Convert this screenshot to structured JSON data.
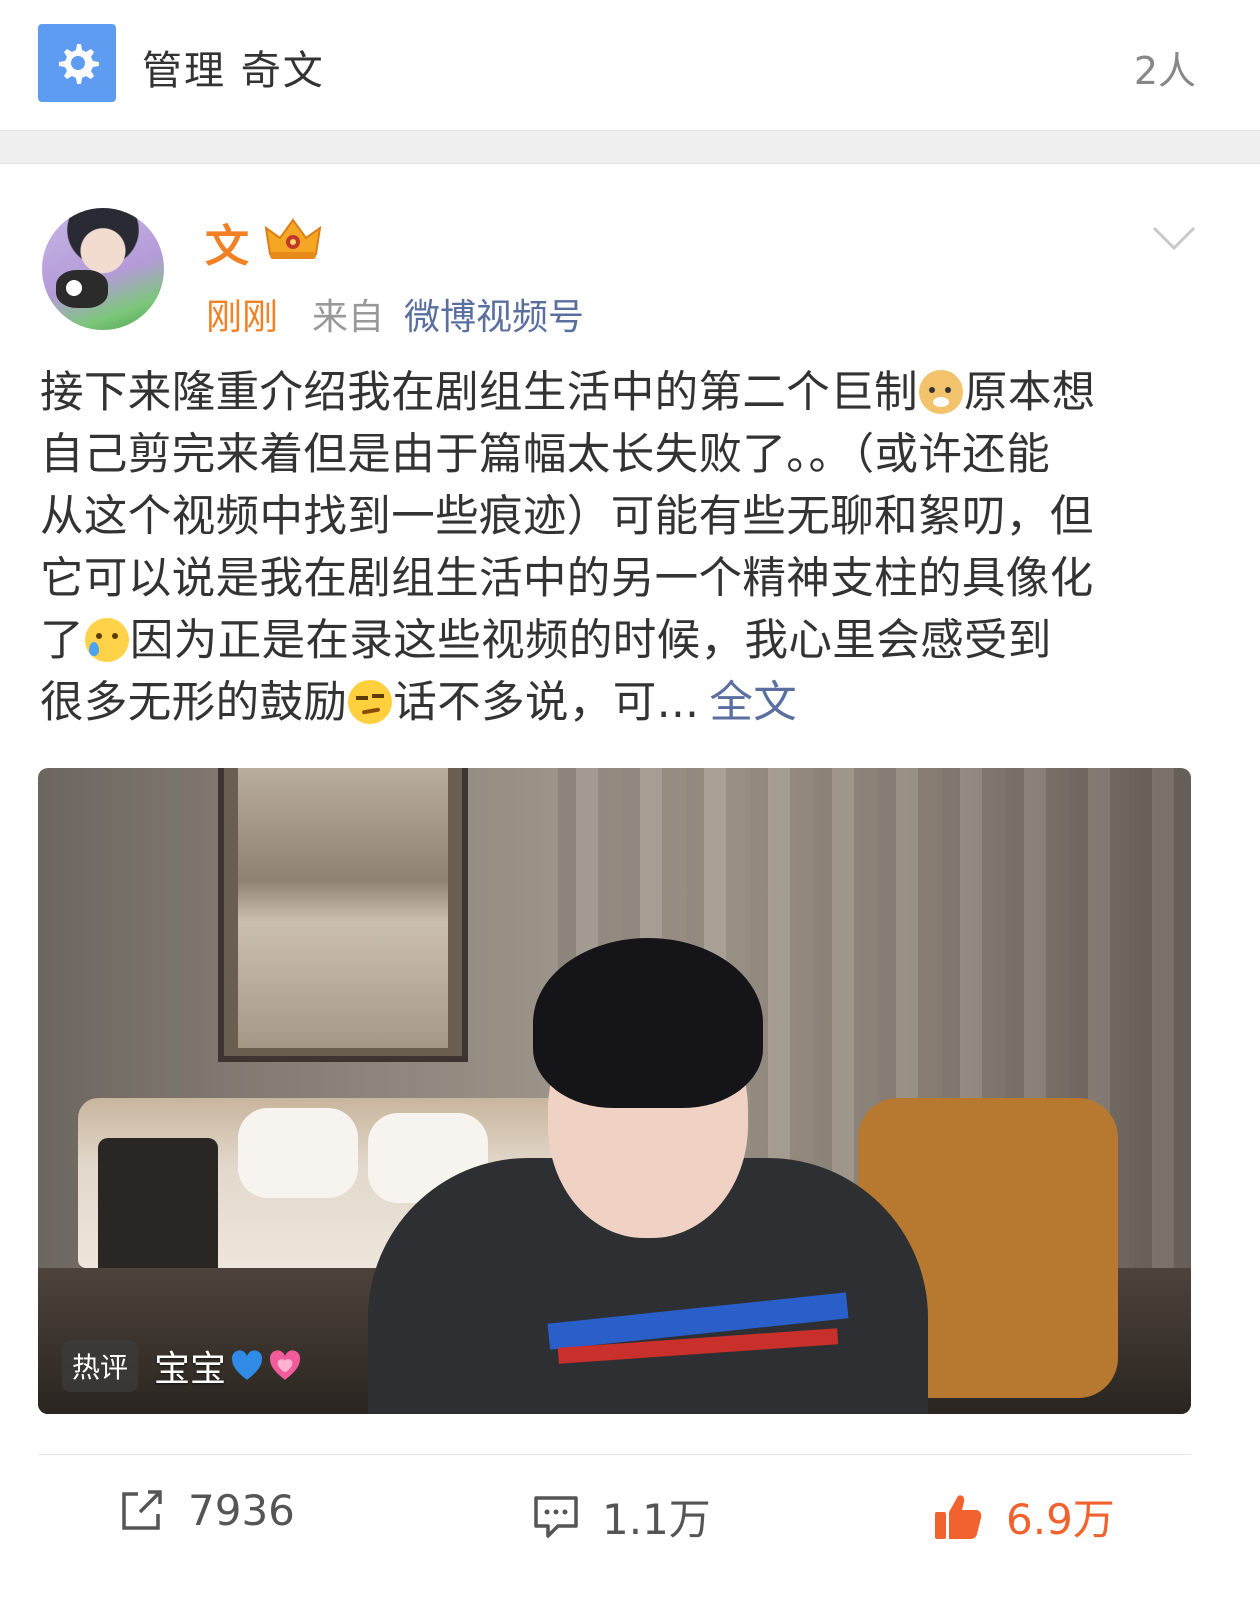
{
  "header": {
    "manage_label": "管理 奇文",
    "member_count": "2人",
    "icon": "gear-icon",
    "icon_bg_color": "#5d9cf0"
  },
  "post": {
    "username": "文",
    "username_color": "#f28025",
    "badge_icon": "crown-icon",
    "time": "刚刚",
    "from_label": "来自",
    "source": "微博视频号",
    "text_lines": [
      [
        "接下来隆重介绍我在剧组生活中的第二个巨制",
        "原本想"
      ],
      [
        "自己剪完来着但是由于篇幅太长失败了。。（或许还能"
      ],
      [
        "从这个视频中找到一些痕迹）可能有些无聊和絮叨，但"
      ],
      [
        "它可以说是我在剧组生活中的另一个精神支柱的具像化"
      ],
      [
        "了",
        "因为正是在录这些视频的时候，我心里会感受到"
      ],
      [
        "很多无形的鼓励",
        "话不多说，可..."
      ]
    ],
    "emojis": [
      "doge-emoji",
      "tear-smile-emoji",
      "smirk-emoji"
    ],
    "more_label": "全文",
    "link_color": "#5a6fa0"
  },
  "video": {
    "hot_badge": "热评",
    "hot_comment": "宝宝",
    "hot_comment_icons": [
      "blue-heart-icon",
      "pink-heart-icon"
    ]
  },
  "actions": {
    "share_count": "7936",
    "comment_count": "1.1万",
    "like_count": "6.9万",
    "like_color": "#f2622e"
  }
}
